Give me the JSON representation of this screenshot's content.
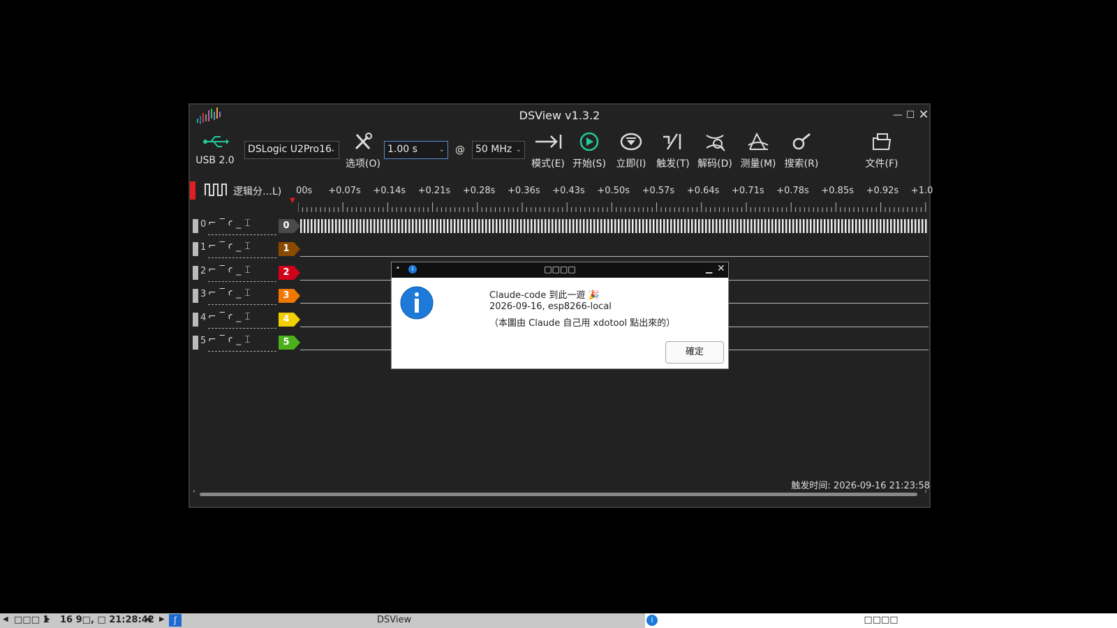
{
  "window": {
    "title": "DSView v1.3.2",
    "minimize_glyph": "—",
    "maximize_glyph": "☐",
    "close_glyph": "✕"
  },
  "toolbar": {
    "usb_label": "USB 2.0",
    "device": "DSLogic U2Pro16",
    "options_label": "选项(O)",
    "duration": "1.00 s",
    "at": "@",
    "rate": "50 MHz",
    "mode_label": "模式(E)",
    "start_label": "开始(S)",
    "instant_label": "立即(I)",
    "trigger_label": "触发(T)",
    "decode_label": "解码(D)",
    "measure_label": "测量(M)",
    "search_label": "搜索(R)",
    "file_label": "文件(F)"
  },
  "ruler": {
    "group_label": "逻辑分…L)",
    "ticks": [
      "00s",
      "+0.07s",
      "+0.14s",
      "+0.21s",
      "+0.28s",
      "+0.36s",
      "+0.43s",
      "+0.50s",
      "+0.57s",
      "+0.64s",
      "+0.71s",
      "+0.78s",
      "+0.85s",
      "+0.92s",
      "+1.0"
    ]
  },
  "channels": [
    {
      "index": "0",
      "tag": "0",
      "color": "#4a4a4a"
    },
    {
      "index": "1",
      "tag": "1",
      "color": "#8a4a00"
    },
    {
      "index": "2",
      "tag": "2",
      "color": "#d0021b"
    },
    {
      "index": "3",
      "tag": "3",
      "color": "#f07800"
    },
    {
      "index": "4",
      "tag": "4",
      "color": "#f0d000"
    },
    {
      "index": "5",
      "tag": "5",
      "color": "#4cb01c"
    }
  ],
  "edge_glyphs": "⌐‾ꜥ_⌶",
  "status": {
    "trigger_time": "触发时间: 2026-09-16 21:23:58"
  },
  "dialog": {
    "title": "□□□□",
    "line1": "Claude-code 到此一遊 🎉",
    "line2": "2026-09-16, esp8266-local",
    "line3": "（本圖由 Claude 自己用 xdotool 點出來的）",
    "ok_label": "確定"
  },
  "taskbar": {
    "workspace": "□□□ 1",
    "clock": "16 9□, □ 21:28:42",
    "task_dsview": "DSView",
    "task_dialog": "□□□□"
  }
}
